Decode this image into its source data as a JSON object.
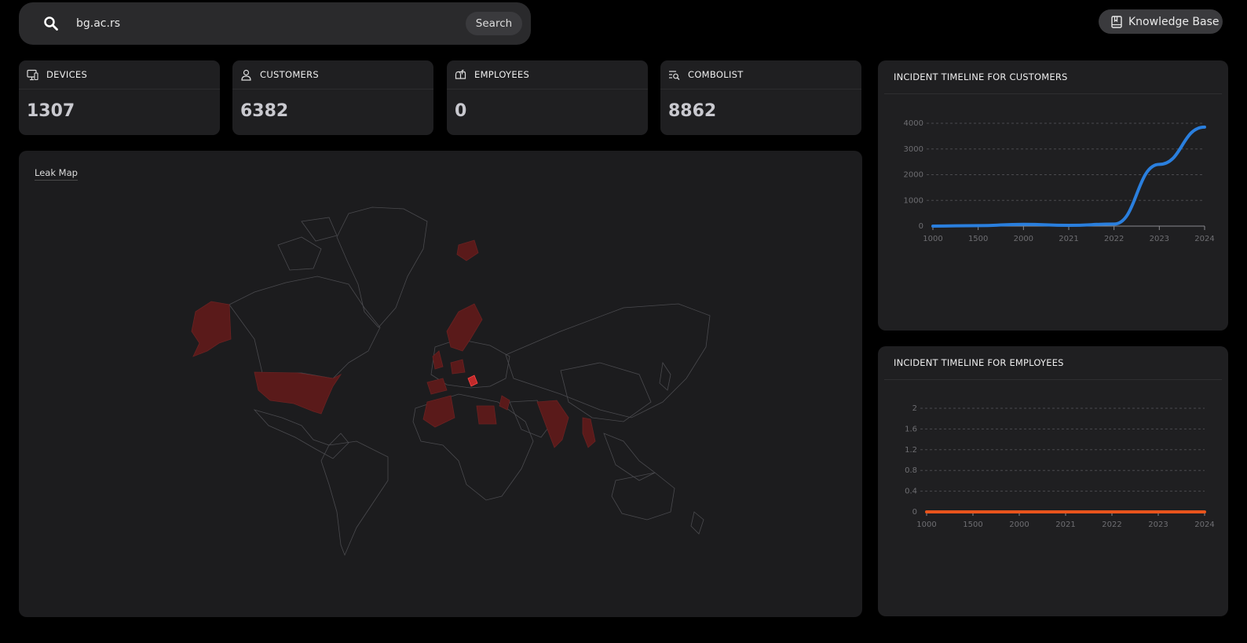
{
  "search": {
    "value": "bg.ac.rs",
    "button_label": "Search"
  },
  "header": {
    "knowledge_base_label": "Knowledge Base"
  },
  "stats": [
    {
      "label": "DEVICES",
      "value": "1307",
      "icon": "monitor-icon"
    },
    {
      "label": "CUSTOMERS",
      "value": "6382",
      "icon": "user-icon"
    },
    {
      "label": "EMPLOYEES",
      "value": "0",
      "icon": "mailbox-icon"
    },
    {
      "label": "COMBOLIST",
      "value": "8862",
      "icon": "list-search-icon"
    }
  ],
  "map": {
    "title": "Leak Map",
    "highlight_color": "#5a1a1a",
    "border_color": "#4a4a4e"
  },
  "chart_data": [
    {
      "type": "line",
      "title": "INCIDENT TIMELINE FOR CUSTOMERS",
      "x": [
        "1000",
        "1500",
        "2000",
        "2021",
        "2022",
        "2023",
        "2024"
      ],
      "series": [
        {
          "values": [
            0,
            20,
            70,
            30,
            80,
            2400,
            3850
          ],
          "color": "#2a7fde"
        }
      ],
      "y_ticks": [
        "0",
        "1000",
        "2000",
        "3000",
        "4000"
      ],
      "ylim": [
        0,
        4000
      ],
      "grid": true
    },
    {
      "type": "line",
      "title": "INCIDENT TIMELINE FOR EMPLOYEES",
      "x": [
        "1000",
        "1500",
        "2000",
        "2021",
        "2022",
        "2023",
        "2024"
      ],
      "series": [
        {
          "values": [
            0,
            0,
            0,
            0,
            0,
            0,
            0
          ],
          "color": "#e8541c"
        }
      ],
      "y_ticks": [
        "0",
        "0.4",
        "0.8",
        "1.2",
        "1.6",
        "2"
      ],
      "ylim": [
        0,
        2
      ],
      "grid": true
    }
  ]
}
